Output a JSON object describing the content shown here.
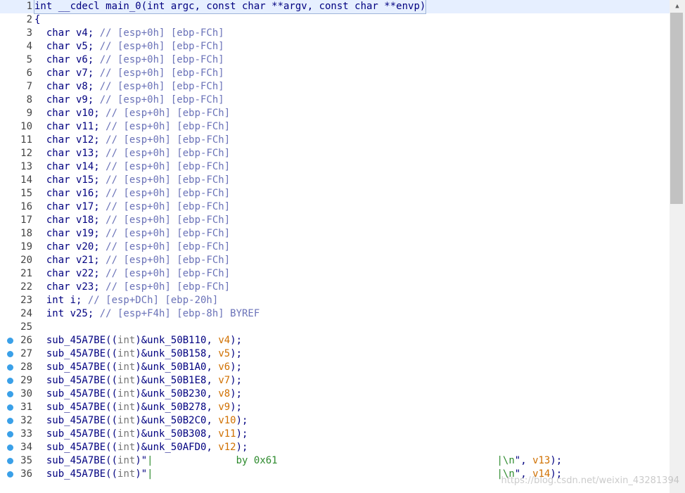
{
  "lines": [
    {
      "n": "1",
      "bp": false,
      "tokens": [
        [
          "kw",
          "int __cdecl main_0(int argc, const char **argv, const char **envp)"
        ]
      ]
    },
    {
      "n": "2",
      "bp": false,
      "tokens": [
        [
          "kw",
          "{"
        ]
      ]
    },
    {
      "n": "3",
      "bp": false,
      "tokens": [
        [
          "kw",
          "  char v4; "
        ],
        [
          "cm",
          "// [esp+0h] [ebp-FCh]"
        ]
      ]
    },
    {
      "n": "4",
      "bp": false,
      "tokens": [
        [
          "kw",
          "  char v5; "
        ],
        [
          "cm",
          "// [esp+0h] [ebp-FCh]"
        ]
      ]
    },
    {
      "n": "5",
      "bp": false,
      "tokens": [
        [
          "kw",
          "  char v6; "
        ],
        [
          "cm",
          "// [esp+0h] [ebp-FCh]"
        ]
      ]
    },
    {
      "n": "6",
      "bp": false,
      "tokens": [
        [
          "kw",
          "  char v7; "
        ],
        [
          "cm",
          "// [esp+0h] [ebp-FCh]"
        ]
      ]
    },
    {
      "n": "7",
      "bp": false,
      "tokens": [
        [
          "kw",
          "  char v8; "
        ],
        [
          "cm",
          "// [esp+0h] [ebp-FCh]"
        ]
      ]
    },
    {
      "n": "8",
      "bp": false,
      "tokens": [
        [
          "kw",
          "  char v9; "
        ],
        [
          "cm",
          "// [esp+0h] [ebp-FCh]"
        ]
      ]
    },
    {
      "n": "9",
      "bp": false,
      "tokens": [
        [
          "kw",
          "  char v10; "
        ],
        [
          "cm",
          "// [esp+0h] [ebp-FCh]"
        ]
      ]
    },
    {
      "n": "10",
      "bp": false,
      "tokens": [
        [
          "kw",
          "  char v11; "
        ],
        [
          "cm",
          "// [esp+0h] [ebp-FCh]"
        ]
      ]
    },
    {
      "n": "11",
      "bp": false,
      "tokens": [
        [
          "kw",
          "  char v12; "
        ],
        [
          "cm",
          "// [esp+0h] [ebp-FCh]"
        ]
      ]
    },
    {
      "n": "12",
      "bp": false,
      "tokens": [
        [
          "kw",
          "  char v13; "
        ],
        [
          "cm",
          "// [esp+0h] [ebp-FCh]"
        ]
      ]
    },
    {
      "n": "13",
      "bp": false,
      "tokens": [
        [
          "kw",
          "  char v14; "
        ],
        [
          "cm",
          "// [esp+0h] [ebp-FCh]"
        ]
      ]
    },
    {
      "n": "14",
      "bp": false,
      "tokens": [
        [
          "kw",
          "  char v15; "
        ],
        [
          "cm",
          "// [esp+0h] [ebp-FCh]"
        ]
      ]
    },
    {
      "n": "15",
      "bp": false,
      "tokens": [
        [
          "kw",
          "  char v16; "
        ],
        [
          "cm",
          "// [esp+0h] [ebp-FCh]"
        ]
      ]
    },
    {
      "n": "16",
      "bp": false,
      "tokens": [
        [
          "kw",
          "  char v17; "
        ],
        [
          "cm",
          "// [esp+0h] [ebp-FCh]"
        ]
      ]
    },
    {
      "n": "17",
      "bp": false,
      "tokens": [
        [
          "kw",
          "  char v18; "
        ],
        [
          "cm",
          "// [esp+0h] [ebp-FCh]"
        ]
      ]
    },
    {
      "n": "18",
      "bp": false,
      "tokens": [
        [
          "kw",
          "  char v19; "
        ],
        [
          "cm",
          "// [esp+0h] [ebp-FCh]"
        ]
      ]
    },
    {
      "n": "19",
      "bp": false,
      "tokens": [
        [
          "kw",
          "  char v20; "
        ],
        [
          "cm",
          "// [esp+0h] [ebp-FCh]"
        ]
      ]
    },
    {
      "n": "20",
      "bp": false,
      "tokens": [
        [
          "kw",
          "  char v21; "
        ],
        [
          "cm",
          "// [esp+0h] [ebp-FCh]"
        ]
      ]
    },
    {
      "n": "21",
      "bp": false,
      "tokens": [
        [
          "kw",
          "  char v22; "
        ],
        [
          "cm",
          "// [esp+0h] [ebp-FCh]"
        ]
      ]
    },
    {
      "n": "22",
      "bp": false,
      "tokens": [
        [
          "kw",
          "  char v23; "
        ],
        [
          "cm",
          "// [esp+0h] [ebp-FCh]"
        ]
      ]
    },
    {
      "n": "23",
      "bp": false,
      "tokens": [
        [
          "kw",
          "  int i; "
        ],
        [
          "cm",
          "// [esp+DCh] [ebp-20h]"
        ]
      ]
    },
    {
      "n": "24",
      "bp": false,
      "tokens": [
        [
          "kw",
          "  int v25; "
        ],
        [
          "cm",
          "// [esp+F4h] [ebp-8h] BYREF"
        ]
      ]
    },
    {
      "n": "25",
      "bp": false,
      "tokens": [
        [
          "kw",
          ""
        ]
      ]
    },
    {
      "n": "26",
      "bp": true,
      "tokens": [
        [
          "kw",
          "  sub_45A7BE(("
        ],
        [
          "gray",
          "int"
        ],
        [
          "kw",
          ")&unk_50B110, "
        ],
        [
          "orange",
          "v4"
        ],
        [
          "kw",
          ");"
        ]
      ]
    },
    {
      "n": "27",
      "bp": true,
      "tokens": [
        [
          "kw",
          "  sub_45A7BE(("
        ],
        [
          "gray",
          "int"
        ],
        [
          "kw",
          ")&unk_50B158, "
        ],
        [
          "orange",
          "v5"
        ],
        [
          "kw",
          ");"
        ]
      ]
    },
    {
      "n": "28",
      "bp": true,
      "tokens": [
        [
          "kw",
          "  sub_45A7BE(("
        ],
        [
          "gray",
          "int"
        ],
        [
          "kw",
          ")&unk_50B1A0, "
        ],
        [
          "orange",
          "v6"
        ],
        [
          "kw",
          ");"
        ]
      ]
    },
    {
      "n": "29",
      "bp": true,
      "tokens": [
        [
          "kw",
          "  sub_45A7BE(("
        ],
        [
          "gray",
          "int"
        ],
        [
          "kw",
          ")&unk_50B1E8, "
        ],
        [
          "orange",
          "v7"
        ],
        [
          "kw",
          ");"
        ]
      ]
    },
    {
      "n": "30",
      "bp": true,
      "tokens": [
        [
          "kw",
          "  sub_45A7BE(("
        ],
        [
          "gray",
          "int"
        ],
        [
          "kw",
          ")&unk_50B230, "
        ],
        [
          "orange",
          "v8"
        ],
        [
          "kw",
          ");"
        ]
      ]
    },
    {
      "n": "31",
      "bp": true,
      "tokens": [
        [
          "kw",
          "  sub_45A7BE(("
        ],
        [
          "gray",
          "int"
        ],
        [
          "kw",
          ")&unk_50B278, "
        ],
        [
          "orange",
          "v9"
        ],
        [
          "kw",
          ");"
        ]
      ]
    },
    {
      "n": "32",
      "bp": true,
      "tokens": [
        [
          "kw",
          "  sub_45A7BE(("
        ],
        [
          "gray",
          "int"
        ],
        [
          "kw",
          ")&unk_50B2C0, "
        ],
        [
          "orange",
          "v10"
        ],
        [
          "kw",
          ");"
        ]
      ]
    },
    {
      "n": "33",
      "bp": true,
      "tokens": [
        [
          "kw",
          "  sub_45A7BE(("
        ],
        [
          "gray",
          "int"
        ],
        [
          "kw",
          ")&unk_50B308, "
        ],
        [
          "orange",
          "v11"
        ],
        [
          "kw",
          ");"
        ]
      ]
    },
    {
      "n": "34",
      "bp": true,
      "tokens": [
        [
          "kw",
          "  sub_45A7BE(("
        ],
        [
          "gray",
          "int"
        ],
        [
          "kw",
          ")&unk_50AFD0, "
        ],
        [
          "orange",
          "v12"
        ],
        [
          "kw",
          ");"
        ]
      ]
    },
    {
      "n": "35",
      "bp": true,
      "tokens": [
        [
          "kw",
          "  sub_45A7BE(("
        ],
        [
          "gray",
          "int"
        ],
        [
          "kw",
          ")\""
        ],
        [
          "str",
          "|              by 0x61                                     |\\n"
        ],
        [
          "kw",
          "\", "
        ],
        [
          "orange",
          "v13"
        ],
        [
          "kw",
          ");"
        ]
      ]
    },
    {
      "n": "36",
      "bp": true,
      "tokens": [
        [
          "kw",
          "  sub_45A7BE(("
        ],
        [
          "gray",
          "int"
        ],
        [
          "kw",
          ")\""
        ],
        [
          "str",
          "|                                                          |\\n"
        ],
        [
          "kw",
          "\", "
        ],
        [
          "orange",
          "v14"
        ],
        [
          "kw",
          ");"
        ]
      ]
    }
  ],
  "watermark": "https://blog.csdn.net/weixin_43281394",
  "colors": {
    "keyword": "#000080",
    "comment": "#6a72b8",
    "string": "#2e8b2e",
    "variable": "#d07000",
    "breakpoint": "#3aa0e8"
  },
  "icons": {
    "scroll_up": "triangle-up-icon",
    "breakpoint": "breakpoint-dot-icon"
  }
}
